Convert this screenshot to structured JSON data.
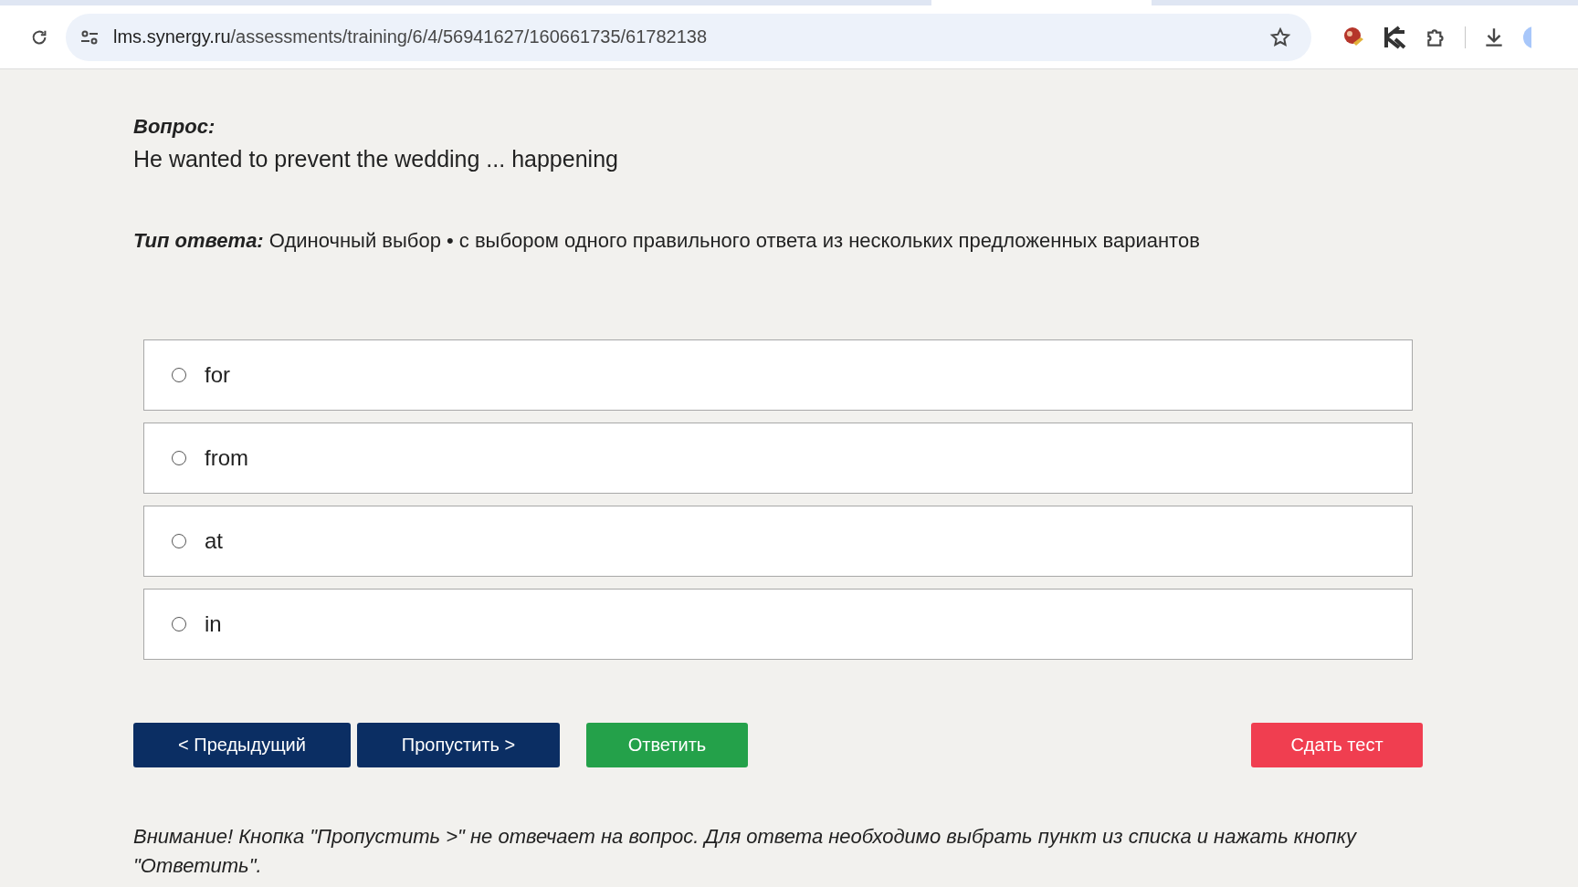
{
  "browser": {
    "url_host": "lms.synergy.ru",
    "url_path": "/assessments/training/6/4/56941627/160661735/61782138"
  },
  "question": {
    "label": "Вопрос:",
    "text": "He wanted to prevent the wedding ... happening"
  },
  "answer_type": {
    "label": "Тип ответа:",
    "text": "Одиночный выбор • с выбором одного правильного ответа из нескольких предложенных вариантов"
  },
  "options": [
    {
      "label": "for",
      "selected": false
    },
    {
      "label": "from",
      "selected": false
    },
    {
      "label": "at",
      "selected": false
    },
    {
      "label": "in",
      "selected": false
    }
  ],
  "buttons": [
    {
      "label": "< Предыдущий",
      "kind": "nav"
    },
    {
      "label": "Пропустить >",
      "kind": "nav"
    },
    {
      "label": "Ответить",
      "kind": "answer"
    },
    {
      "label": "Сдать тест",
      "kind": "submit"
    }
  ],
  "notice": "Внимание! Кнопка \"Пропустить >\" не отвечает на вопрос. Для ответа необходимо выбрать пункт из списка и нажать кнопку \"Ответить\"."
}
